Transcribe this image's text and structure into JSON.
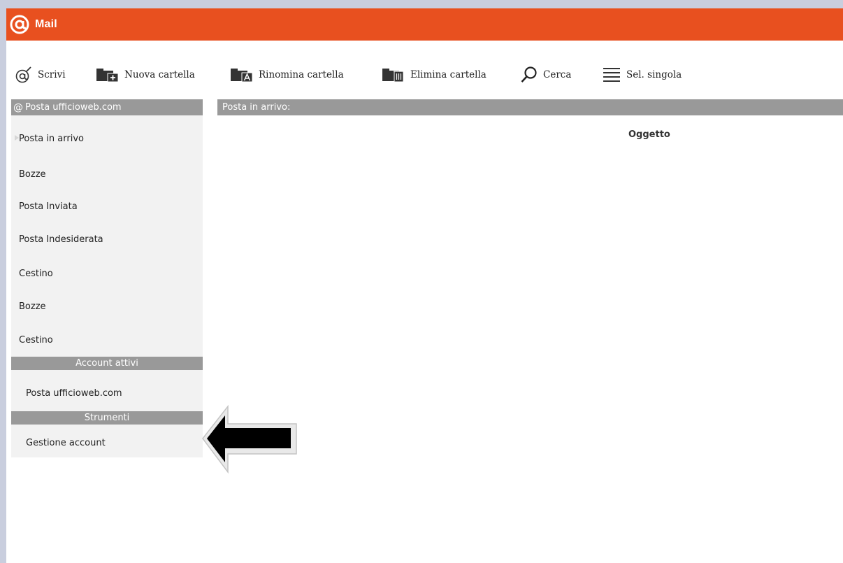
{
  "app": {
    "title": "Mail",
    "accent_color": "#e8501f",
    "header_gray": "#999999"
  },
  "toolbar": {
    "items": [
      {
        "label": "Scrivi",
        "icon": "compose-at-icon"
      },
      {
        "label": "Nuova cartella",
        "icon": "new-folder-icon"
      },
      {
        "label": "Rinomina cartella",
        "icon": "rename-folder-icon"
      },
      {
        "label": "Elimina cartella",
        "icon": "delete-folder-icon"
      },
      {
        "label": "Cerca",
        "icon": "search-icon"
      },
      {
        "label": "Sel. singola",
        "icon": "list-select-icon"
      }
    ]
  },
  "sidebar": {
    "account_header": "Posta ufficioweb.com",
    "folders": [
      "Posta in arrivo",
      "Bozze",
      "Posta Inviata",
      "Posta Indesiderata",
      "Cestino",
      "Bozze",
      "Cestino"
    ],
    "active_accounts_header": "Account attivi",
    "active_accounts": [
      "Posta ufficioweb.com"
    ],
    "tools_header": "Strumenti",
    "tools": [
      "Gestione account"
    ]
  },
  "main": {
    "header": "Posta in arrivo:",
    "columns": [
      "Oggetto"
    ]
  },
  "annotation": {
    "icon": "arrow-left-icon"
  }
}
